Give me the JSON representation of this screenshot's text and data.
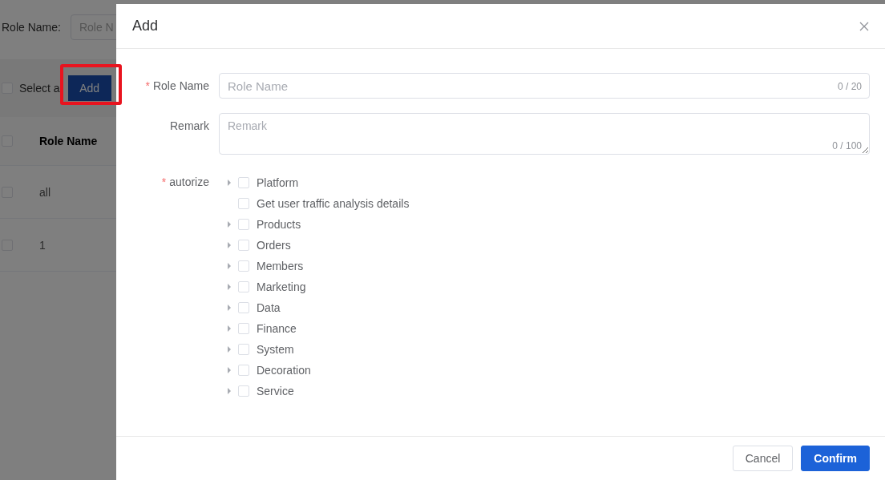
{
  "page": {
    "filter": {
      "label": "Role Name:",
      "placeholder": "Role N"
    },
    "toolbar": {
      "select_all": {
        "label": "Select a",
        "checked": false
      },
      "add_button": "Add",
      "highlighted": true
    },
    "table": {
      "select_all_checked": false,
      "columns": [
        "Role Name"
      ],
      "rows": [
        {
          "cells": [
            "all"
          ],
          "checked": false
        },
        {
          "cells": [
            "1"
          ],
          "checked": false
        }
      ]
    }
  },
  "drawer": {
    "title": "Add",
    "fields": [
      {
        "kind": "input",
        "label": "Role Name",
        "required_mark": "*",
        "placeholder": "Role Name",
        "counter": "0 / 20"
      },
      {
        "kind": "textarea",
        "label": "Remark",
        "placeholder": "Remark",
        "counter": "0 / 100"
      },
      {
        "kind": "tree",
        "label": "autorize",
        "required_mark": "*",
        "items": [
          {
            "label": "Platform",
            "expandable": true,
            "checked": false
          },
          {
            "label": "Get user traffic analysis details",
            "expandable": false,
            "checked": false
          },
          {
            "label": "Products",
            "expandable": true,
            "checked": false
          },
          {
            "label": "Orders",
            "expandable": true,
            "checked": false
          },
          {
            "label": "Members",
            "expandable": true,
            "checked": false
          },
          {
            "label": "Marketing",
            "expandable": true,
            "checked": false
          },
          {
            "label": "Data",
            "expandable": true,
            "checked": false
          },
          {
            "label": "Finance",
            "expandable": true,
            "checked": false
          },
          {
            "label": "System",
            "expandable": true,
            "checked": false
          },
          {
            "label": "Decoration",
            "expandable": true,
            "checked": false
          },
          {
            "label": "Service",
            "expandable": true,
            "checked": false
          }
        ]
      }
    ],
    "buttons": [
      {
        "label": "Cancel",
        "primary": false
      },
      {
        "label": "Confirm",
        "primary": true
      }
    ]
  }
}
